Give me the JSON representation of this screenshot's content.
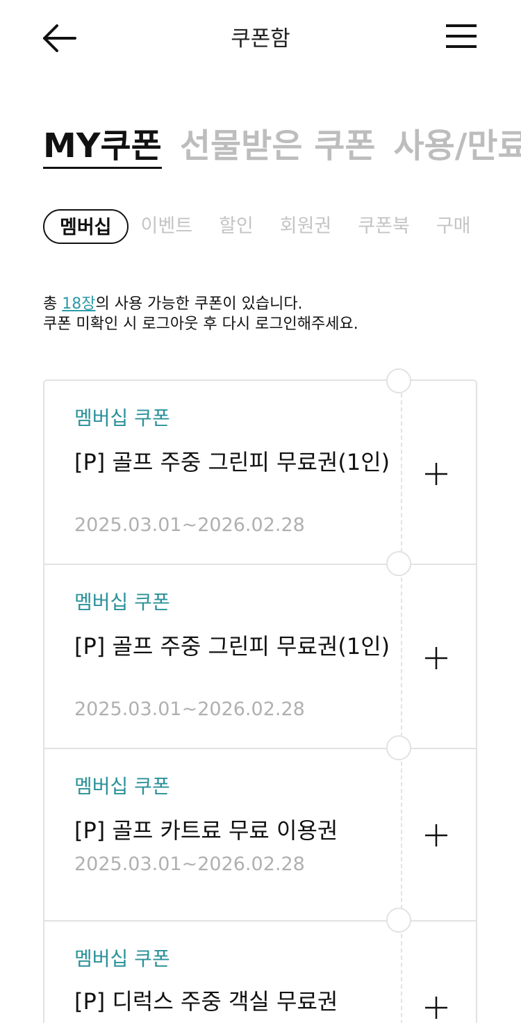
{
  "header": {
    "title": "쿠폰함",
    "back_icon": "arrow-left-icon",
    "menu_icon": "hamburger-menu-icon"
  },
  "main_tabs": [
    {
      "label": "MY쿠폰",
      "active": true
    },
    {
      "label": "선물받은 쿠폰",
      "active": false
    },
    {
      "label": "사용/만료",
      "active": false
    }
  ],
  "sub_tabs": [
    {
      "label": "멤버십",
      "active": true
    },
    {
      "label": "이벤트",
      "active": false
    },
    {
      "label": "할인",
      "active": false
    },
    {
      "label": "회원권",
      "active": false
    },
    {
      "label": "쿠폰북",
      "active": false
    },
    {
      "label": "구매",
      "active": false
    }
  ],
  "notice": {
    "prefix": "총 ",
    "count": "18장",
    "suffix": "의 사용 가능한 쿠폰이 있습니다.",
    "line2": "쿠폰 미확인 시 로그아웃 후 다시 로그인해주세요."
  },
  "coupons": [
    {
      "type": "멤버십 쿠폰",
      "name": "[P] 골프 주중 그린피 무료권(1인)",
      "period": "2025.03.01~2026.02.28"
    },
    {
      "type": "멤버십 쿠폰",
      "name": "[P] 골프 주중 그린피 무료권(1인)",
      "period": "2025.03.01~2026.02.28"
    },
    {
      "type": "멤버십 쿠폰",
      "name": "[P] 골프 카트료 무료 이용권",
      "period": "2025.03.01~2026.02.28"
    },
    {
      "type": "멤버십 쿠폰",
      "name": "[P] 디럭스 주중 객실 무료권",
      "period": ""
    }
  ],
  "colors": {
    "accent": "#2b9aa8",
    "coupon_type": "#2a9198",
    "inactive": "#bdbdbd",
    "border": "#e2e2e2"
  }
}
